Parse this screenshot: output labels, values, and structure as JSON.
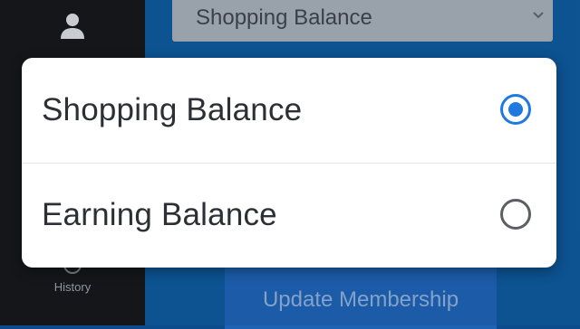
{
  "sidebar": {
    "items": [
      {
        "label": "",
        "icon": "person-icon"
      },
      {
        "label": "History",
        "icon": "clock-icon"
      }
    ]
  },
  "main": {
    "select_value": "Shopping Balance",
    "update_button": "Update Membership"
  },
  "dialog": {
    "options": [
      {
        "label": "Shopping Balance",
        "selected": true
      },
      {
        "label": "Earning Balance",
        "selected": false
      }
    ]
  },
  "colors": {
    "accent": "#1f7ae0",
    "sidebar_bg": "#16181d",
    "main_bg": "#0f5a9e"
  }
}
